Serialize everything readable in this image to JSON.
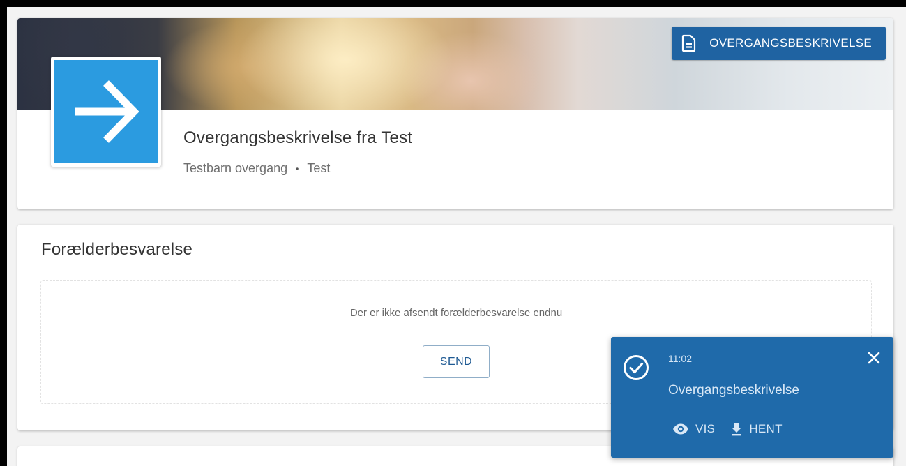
{
  "header": {
    "doc_button_label": "OVERGANGSBESKRIVELSE",
    "title": "Overgangsbeskrivelse fra Test",
    "subtitle_child": "Testbarn overgang",
    "subtitle_separator": "•",
    "subtitle_org": "Test"
  },
  "parent_response": {
    "title": "Forælderbesvarelse",
    "empty_message": "Der er ikke afsendt forælderbesvarelse endnu",
    "send_label": "SEND"
  },
  "toast": {
    "time": "11:02",
    "title": "Overgangsbeskrivelse",
    "view_label": "VIS",
    "download_label": "HENT"
  },
  "colors": {
    "primary": "#1f63a2",
    "logo_blue": "#2b9be0",
    "toast_bg": "#1f6aaa"
  },
  "icons": [
    "document-icon",
    "arrow-right-icon",
    "check-circle-icon",
    "close-icon",
    "eye-icon",
    "download-icon"
  ]
}
